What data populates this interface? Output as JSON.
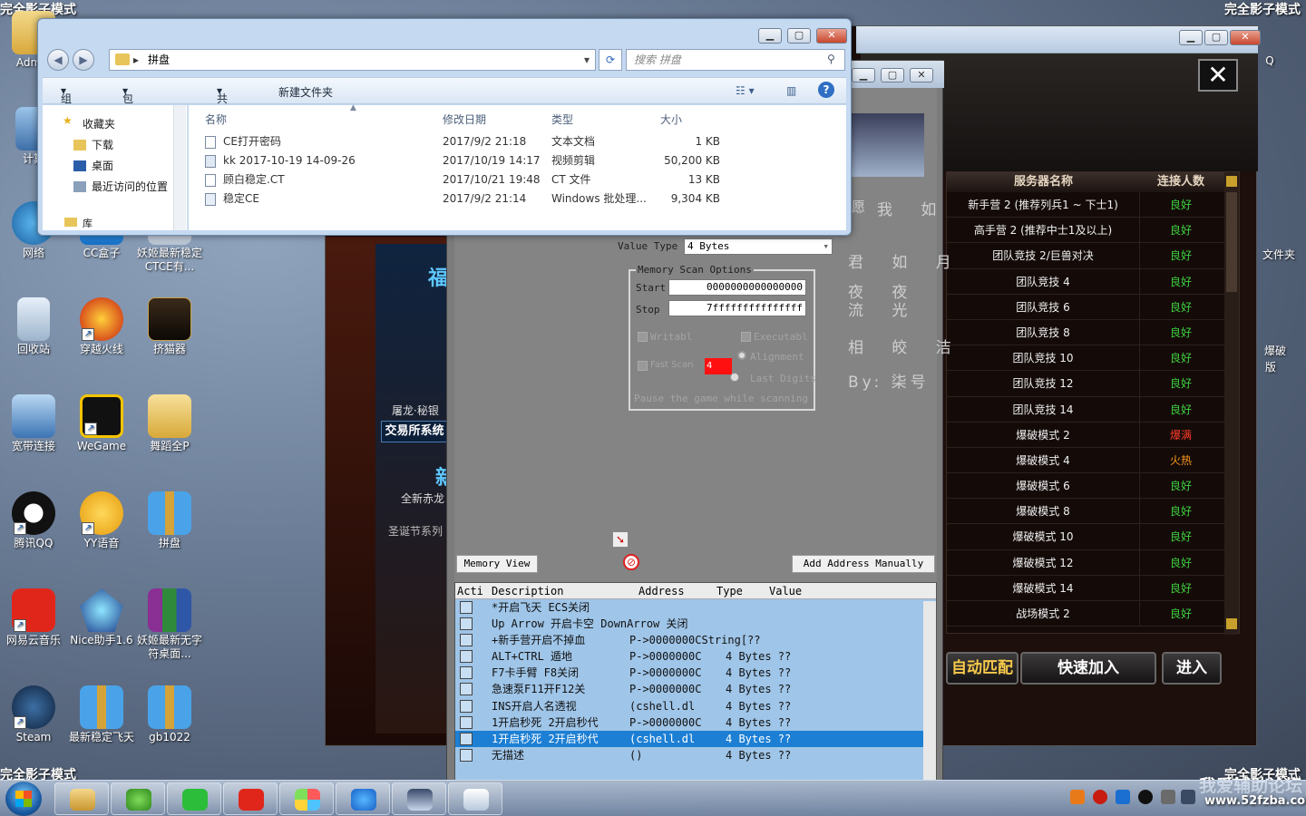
{
  "desktop": {
    "corner_labels": [
      "完全影子模式",
      "完全影子模式",
      "完全影子模式",
      "完全影子模式"
    ],
    "icons": [
      {
        "label": "Admin",
        "icon": "user-folder-icon"
      },
      {
        "label": "计算",
        "icon": "computer-icon"
      },
      {
        "label": "网络",
        "icon": "network-icon"
      },
      {
        "label": "CC盒子",
        "icon": "cc-box-icon"
      },
      {
        "label": "妖姬最新稳定CTCE有...",
        "icon": "folder-icon"
      },
      {
        "label": "回收站",
        "icon": "recycle-bin-icon"
      },
      {
        "label": "穿越火线",
        "icon": "crossfire-icon"
      },
      {
        "label": "挤猫器",
        "icon": "app-icon"
      },
      {
        "label": "宽带连接",
        "icon": "broadband-icon"
      },
      {
        "label": "WeGame",
        "icon": "wegame-icon"
      },
      {
        "label": "舞蹈全P",
        "icon": "folder-icon"
      },
      {
        "label": "腾讯QQ",
        "icon": "qq-icon"
      },
      {
        "label": "YY语音",
        "icon": "yy-icon"
      },
      {
        "label": "拼盘",
        "icon": "archive-icon"
      },
      {
        "label": "网易云音乐",
        "icon": "netease-music-icon"
      },
      {
        "label": "Nice助手1.6",
        "icon": "nice-helper-icon"
      },
      {
        "label": "妖姬最新无字符桌面...",
        "icon": "winrar-icon"
      },
      {
        "label": "Steam",
        "icon": "steam-icon"
      },
      {
        "label": "最新稳定飞天",
        "icon": "archive-icon"
      },
      {
        "label": "gb1022",
        "icon": "archive-icon"
      }
    ],
    "right_partial_labels": [
      "Q",
      "文件夹",
      "爆破",
      "版"
    ]
  },
  "explorer": {
    "breadcrumb": "拼盘",
    "search_placeholder": "搜索 拼盘",
    "toolbar": [
      "组织",
      "包含到库中",
      "共享",
      "新建文件夹"
    ],
    "nav": [
      "收藏夹",
      "下载",
      "桌面",
      "最近访问的位置",
      "库"
    ],
    "columns": [
      "名称",
      "修改日期",
      "类型",
      "大小"
    ],
    "files": [
      {
        "name": "CE打开密码",
        "date": "2017/9/2 21:18",
        "type": "文本文档",
        "size": "1 KB"
      },
      {
        "name": "kk 2017-10-19 14-09-26",
        "date": "2017/10/19 14:17",
        "type": "视频剪辑",
        "size": "50,200 KB"
      },
      {
        "name": "顾白稳定.CT",
        "date": "2017/10/21 19:48",
        "type": "CT 文件",
        "size": "13 KB"
      },
      {
        "name": "稳定CE",
        "date": "2017/9/2 21:14",
        "type": "Windows 批处理...",
        "size": "9,304 KB"
      }
    ]
  },
  "game": {
    "side_texts": [
      "福",
      "屠龙·秘银",
      "交易所系统",
      "新",
      "全新赤龙",
      "圣诞节系列"
    ],
    "server_headers": [
      "服务器名称",
      "连接人数"
    ],
    "servers": [
      {
        "name": "新手营 2 (推荐列兵1 ~ 下士1)",
        "status": "良好",
        "color": "#3fd13f"
      },
      {
        "name": "高手营 2 (推荐中士1及以上)",
        "status": "良好",
        "color": "#3fd13f"
      },
      {
        "name": "团队竞技 2/巨兽对决",
        "status": "良好",
        "color": "#3fd13f"
      },
      {
        "name": "团队竞技 4",
        "status": "良好",
        "color": "#3fd13f"
      },
      {
        "name": "团队竞技 6",
        "status": "良好",
        "color": "#3fd13f"
      },
      {
        "name": "团队竞技 8",
        "status": "良好",
        "color": "#3fd13f"
      },
      {
        "name": "团队竞技 10",
        "status": "良好",
        "color": "#3fd13f"
      },
      {
        "name": "团队竞技 12",
        "status": "良好",
        "color": "#3fd13f"
      },
      {
        "name": "团队竞技 14",
        "status": "良好",
        "color": "#3fd13f"
      },
      {
        "name": "爆破模式 2",
        "status": "爆满",
        "color": "#ff3b2a"
      },
      {
        "name": "爆破模式 4",
        "status": "火热",
        "color": "#ff9a1a"
      },
      {
        "name": "爆破模式 6",
        "status": "良好",
        "color": "#3fd13f"
      },
      {
        "name": "爆破模式 8",
        "status": "良好",
        "color": "#3fd13f"
      },
      {
        "name": "爆破模式 10",
        "status": "良好",
        "color": "#3fd13f"
      },
      {
        "name": "爆破模式 12",
        "status": "良好",
        "color": "#3fd13f"
      },
      {
        "name": "爆破模式 14",
        "status": "良好",
        "color": "#3fd13f"
      },
      {
        "name": "战场模式 2",
        "status": "良好",
        "color": "#3fd13f"
      }
    ],
    "buttons": [
      "自动匹配",
      "快速加入",
      "进入"
    ]
  },
  "ce": {
    "value_type_label": "Value Type",
    "value_type": "4 Bytes",
    "scan_options_title": "Memory Scan Options",
    "start_label": "Start",
    "start_value": "0000000000000000",
    "stop_label": "Stop",
    "stop_value": "7fffffffffffffff",
    "writable": "Writabl",
    "executable": "Executabl",
    "fast_scan": "Fast Scan",
    "fast_scan_value": "4",
    "alignment": "Alignment",
    "last_digits": "Last Digits",
    "pause": "Pause the game while scanning",
    "poem": [
      "我 如",
      "君 如 月",
      "夜 夜 流 光",
      "相 皎 洁",
      "By: 柒号"
    ],
    "poem_side": "愿",
    "memory_view": "Memory View",
    "add_address": "Add Address Manually",
    "table_headers": [
      "Acti",
      "Description",
      "Address",
      "Type",
      "Value"
    ],
    "rows": [
      {
        "desc": "*开启飞天  ECS关闭",
        "addr": "",
        "type": ""
      },
      {
        "desc": "Up Arrow 开启卡空  DownArrow 关闭",
        "addr": "",
        "type": ""
      },
      {
        "desc": "+新手营开启不掉血",
        "addr": "P->0000000CString[??",
        "type": ""
      },
      {
        "desc": "ALT+CTRL  遁地",
        "addr": "P->0000000C",
        "type": "4 Bytes ??"
      },
      {
        "desc": "F7卡手臂 F8关闭",
        "addr": "P->0000000C",
        "type": "4 Bytes ??"
      },
      {
        "desc": "急速泵F11开F12关",
        "addr": "P->0000000C",
        "type": "4 Bytes ??"
      },
      {
        "desc": "INS开启人名透视",
        "addr": "(cshell.dl",
        "type": "4 Bytes ??"
      },
      {
        "desc": "1开启秒死  2开启秒代",
        "addr": "P->0000000C",
        "type": "4 Bytes ??"
      },
      {
        "desc": "1开启秒死  2开启秒代",
        "addr": "(cshell.dl",
        "type": "4 Bytes ??"
      },
      {
        "desc": "无描述",
        "addr": "()",
        "type": "4 Bytes ??"
      }
    ],
    "selected_row": 8
  },
  "watermark": {
    "line1": "我爱辅助论坛",
    "line2": "www.52fzba.com"
  },
  "taskbar": {
    "apps": [
      "windows-explorer-icon",
      "360-browser-icon",
      "iqiyi-icon",
      "netease-music-icon",
      "xiangyun-icon",
      "wegame-browser-icon",
      "conan-ce-icon",
      "notepad-icon"
    ]
  }
}
